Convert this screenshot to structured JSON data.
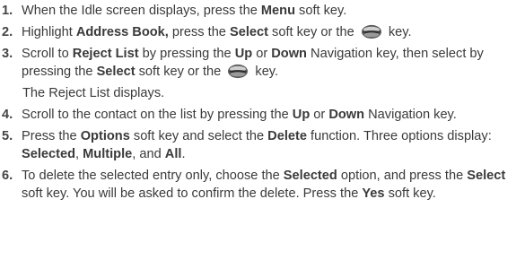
{
  "steps": [
    {
      "num": "1.",
      "segments": [
        {
          "t": "When the Idle screen displays, press the "
        },
        {
          "t": "Menu",
          "b": true
        },
        {
          "t": " soft key."
        }
      ]
    },
    {
      "num": "2.",
      "segments": [
        {
          "t": "Highlight "
        },
        {
          "t": "Address Book,",
          "b": true
        },
        {
          "t": " press the "
        },
        {
          "t": "Select",
          "b": true
        },
        {
          "t": " soft key or the "
        },
        {
          "icon": "navigation-key-icon"
        },
        {
          "t": " key."
        }
      ]
    },
    {
      "num": "3.",
      "segments": [
        {
          "t": "Scroll to "
        },
        {
          "t": "Reject List",
          "b": true
        },
        {
          "t": " by pressing the "
        },
        {
          "t": "Up",
          "b": true
        },
        {
          "t": " or "
        },
        {
          "t": "Down",
          "b": true
        },
        {
          "t": " Navigation key, then select by pressing the "
        },
        {
          "t": "Select",
          "b": true
        },
        {
          "t": " soft key or the "
        },
        {
          "icon": "navigation-key-icon"
        },
        {
          "t": " key."
        }
      ],
      "note": "The Reject List displays."
    },
    {
      "num": "4.",
      "segments": [
        {
          "t": "Scroll to the contact on the list by pressing the "
        },
        {
          "t": "Up",
          "b": true
        },
        {
          "t": " or "
        },
        {
          "t": "Down",
          "b": true
        },
        {
          "t": " Navigation key."
        }
      ]
    },
    {
      "num": "5.",
      "segments": [
        {
          "t": "Press the "
        },
        {
          "t": "Options",
          "b": true
        },
        {
          "t": " soft key and select the "
        },
        {
          "t": "Delete",
          "b": true
        },
        {
          "t": " function. Three options display: "
        },
        {
          "t": "Selected",
          "b": true
        },
        {
          "t": ", "
        },
        {
          "t": "Multiple",
          "b": true
        },
        {
          "t": ", and "
        },
        {
          "t": "All",
          "b": true
        },
        {
          "t": "."
        }
      ]
    },
    {
      "num": "6.",
      "segments": [
        {
          "t": "To delete the selected entry only, choose the "
        },
        {
          "t": "Selected",
          "b": true
        },
        {
          "t": " option, and press the "
        },
        {
          "t": "Select",
          "b": true
        },
        {
          "t": " soft key. You will be asked to confirm the delete.  Press the "
        },
        {
          "t": "Yes",
          "b": true
        },
        {
          "t": " soft key."
        }
      ]
    }
  ]
}
